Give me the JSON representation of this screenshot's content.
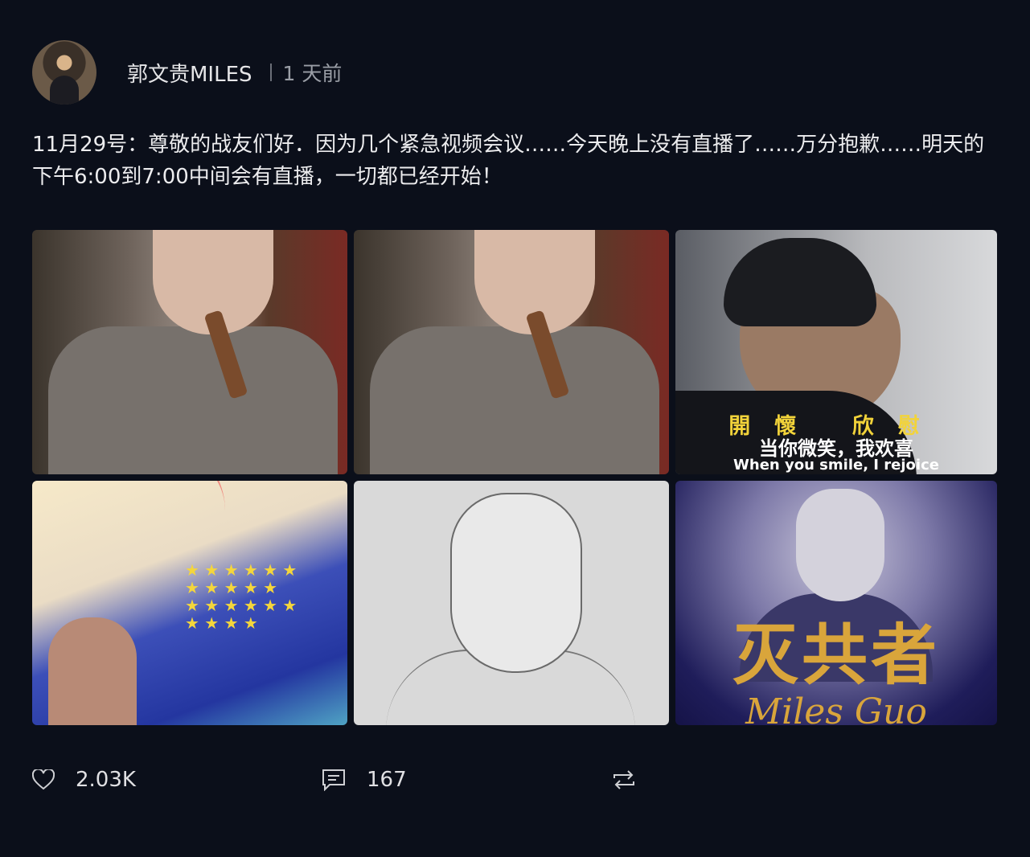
{
  "author": {
    "name": "郭文贵MILES",
    "time_ago": "1 天前"
  },
  "post": {
    "text": "11月29号：尊敬的战友们好．因为几个紧急视频会议……今天晚上没有直播了……万分抱歉……明天的下午6:00到7:00中间会有直播，一切都已经开始！"
  },
  "images": {
    "img3_caption_cn_top": "開懷 欣慰",
    "img3_caption_cn": "当你微笑，我欢喜",
    "img3_caption_en": "When you smile, I rejoice",
    "img6_title": "灭共者",
    "img6_signature": "Miles Guo"
  },
  "actions": {
    "likes": "2.03K",
    "comments": "167"
  }
}
